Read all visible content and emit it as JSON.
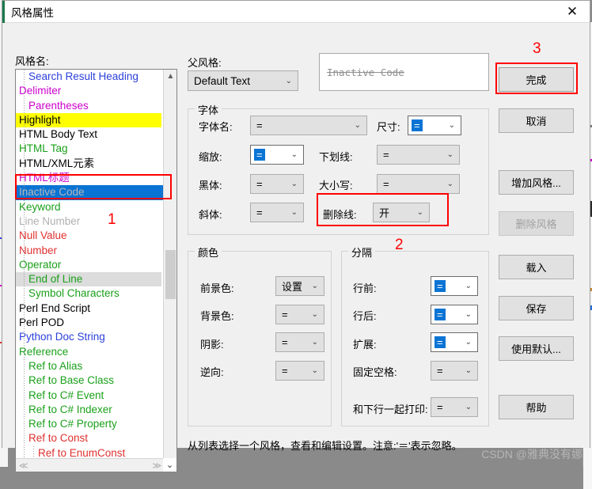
{
  "window": {
    "title": "风格属性",
    "close_icon": "close-icon"
  },
  "left": {
    "style_name_label": "风格名:",
    "items": [
      {
        "text": "Search Result Heading",
        "color": "#2b3fd9",
        "indent": 1,
        "bg": "",
        "fg": ""
      },
      {
        "text": "Delimiter",
        "color": "#cc00cc",
        "indent": 0,
        "bg": "",
        "fg": ""
      },
      {
        "text": "Parentheses",
        "color": "#cc00cc",
        "indent": 1,
        "bg": "",
        "fg": ""
      },
      {
        "text": "Highlight",
        "color": "#000000",
        "indent": 0,
        "bg": "#ffff00",
        "fg": ""
      },
      {
        "text": "HTML Body Text",
        "color": "#000000",
        "indent": 0,
        "bg": "",
        "fg": ""
      },
      {
        "text": "HTML Tag",
        "color": "#1aa01a",
        "indent": 0,
        "bg": "",
        "fg": ""
      },
      {
        "text": "HTML/XML元素",
        "color": "#000000",
        "indent": 0,
        "bg": "",
        "fg": ""
      },
      {
        "text": "HTML标题",
        "color": "#cc00cc",
        "indent": 0,
        "bg": "",
        "fg": ""
      },
      {
        "text": "Inactive Code",
        "color": "#b8b8b8",
        "indent": 0,
        "bg": "#0a74d4",
        "fg": "",
        "selected": true
      },
      {
        "text": "Keyword",
        "color": "#1aa01a",
        "indent": 0,
        "bg": "",
        "fg": ""
      },
      {
        "text": "Line Number",
        "color": "#b0b0b0",
        "indent": 0,
        "bg": "",
        "fg": ""
      },
      {
        "text": "Null Value",
        "color": "#e03030",
        "indent": 0,
        "bg": "",
        "fg": ""
      },
      {
        "text": "Number",
        "color": "#e03030",
        "indent": 0,
        "bg": "",
        "fg": ""
      },
      {
        "text": "Operator",
        "color": "#1aa01a",
        "indent": 0,
        "bg": "",
        "fg": ""
      },
      {
        "text": "End of Line",
        "color": "#1aa01a",
        "indent": 1,
        "bg": "#dcdcdc",
        "fg": ""
      },
      {
        "text": "Symbol Characters",
        "color": "#1aa01a",
        "indent": 1,
        "bg": "",
        "fg": ""
      },
      {
        "text": "Perl End Script",
        "color": "#000000",
        "indent": 0,
        "bg": "",
        "fg": ""
      },
      {
        "text": "Perl POD",
        "color": "#000000",
        "indent": 0,
        "bg": "",
        "fg": ""
      },
      {
        "text": "Python Doc String",
        "color": "#2b3fd9",
        "indent": 0,
        "bg": "",
        "fg": ""
      },
      {
        "text": "Reference",
        "color": "#1aa01a",
        "indent": 0,
        "bg": "",
        "fg": ""
      },
      {
        "text": "Ref to Alias",
        "color": "#1aa01a",
        "indent": 1,
        "bg": "",
        "fg": ""
      },
      {
        "text": "Ref to Base Class",
        "color": "#1aa01a",
        "indent": 1,
        "bg": "",
        "fg": ""
      },
      {
        "text": "Ref to C# Event",
        "color": "#1aa01a",
        "indent": 1,
        "bg": "",
        "fg": ""
      },
      {
        "text": "Ref to C# Indexer",
        "color": "#1aa01a",
        "indent": 1,
        "bg": "",
        "fg": ""
      },
      {
        "text": "Ref to C# Property",
        "color": "#1aa01a",
        "indent": 1,
        "bg": "",
        "fg": ""
      },
      {
        "text": "Ref to Const",
        "color": "#e03030",
        "indent": 1,
        "bg": "",
        "fg": ""
      },
      {
        "text": "Ref to EnumConst",
        "color": "#e03030",
        "indent": 2,
        "bg": "",
        "fg": ""
      }
    ],
    "scroll_up_icon": "chevron-up-icon",
    "scroll_down_icon": "chevron-down-icon",
    "hscroll_left_icon": "chevron-left-icon",
    "hscroll_right_icon": "chevron-right-icon"
  },
  "parent": {
    "label": "父风格:",
    "value": "Default Text"
  },
  "preview": {
    "text": "Inactive Code"
  },
  "font_group": {
    "legend": "字体",
    "fields": [
      {
        "label": "字体名:",
        "value": "=",
        "editable": false
      },
      {
        "label": "尺寸:",
        "value": "=",
        "editable": true
      },
      {
        "label": "缩放:",
        "value": "=",
        "editable": true
      },
      {
        "label": "下划线:",
        "value": "=",
        "editable": false
      },
      {
        "label": "黑体:",
        "value": "=",
        "editable": false
      },
      {
        "label": "大小写:",
        "value": "=",
        "editable": false
      },
      {
        "label": "斜体:",
        "value": "=",
        "editable": false
      },
      {
        "label": "删除线:",
        "value": "开",
        "editable": false
      }
    ]
  },
  "color_group": {
    "legend": "颜色",
    "fields": [
      {
        "label": "前景色:",
        "value": "设置"
      },
      {
        "label": "背景色:",
        "value": "="
      },
      {
        "label": "阴影:",
        "value": "="
      },
      {
        "label": "逆向:",
        "value": "="
      }
    ]
  },
  "space_group": {
    "legend": "分隔",
    "fields": [
      {
        "label": "行前:",
        "value": "=",
        "editable": true
      },
      {
        "label": "行后:",
        "value": "=",
        "editable": true
      },
      {
        "label": "扩展:",
        "value": "=",
        "editable": true
      },
      {
        "label": "固定空格:",
        "value": "=",
        "editable": false
      },
      {
        "label": "和下行一起打印:",
        "value": "=",
        "editable": false
      }
    ]
  },
  "buttons": [
    {
      "label": "完成",
      "disabled": false,
      "primary": true
    },
    {
      "label": "取消",
      "disabled": false,
      "primary": false
    },
    {
      "label": "增加风格...",
      "disabled": false,
      "primary": false
    },
    {
      "label": "删除风格",
      "disabled": true,
      "primary": false
    },
    {
      "label": "载入",
      "disabled": false,
      "primary": false
    },
    {
      "label": "保存",
      "disabled": false,
      "primary": false
    },
    {
      "label": "使用默认...",
      "disabled": false,
      "primary": false
    },
    {
      "label": "帮助",
      "disabled": false,
      "primary": false
    }
  ],
  "status": {
    "text": "从列表选择一个风格，查看和编辑设置。注意:'＝'表示忽略。"
  },
  "markers": [
    {
      "id": "1",
      "label": "1"
    },
    {
      "id": "2",
      "label": "2"
    },
    {
      "id": "3",
      "label": "3"
    }
  ],
  "watermark": {
    "text": "CSDN @雅典没有娜"
  },
  "colors": {
    "selection_blue": "#0a74d4",
    "highlight_yellow": "#ffff00",
    "marker_red": "#ff0000",
    "dialog_bg": "#f0f0f0"
  }
}
